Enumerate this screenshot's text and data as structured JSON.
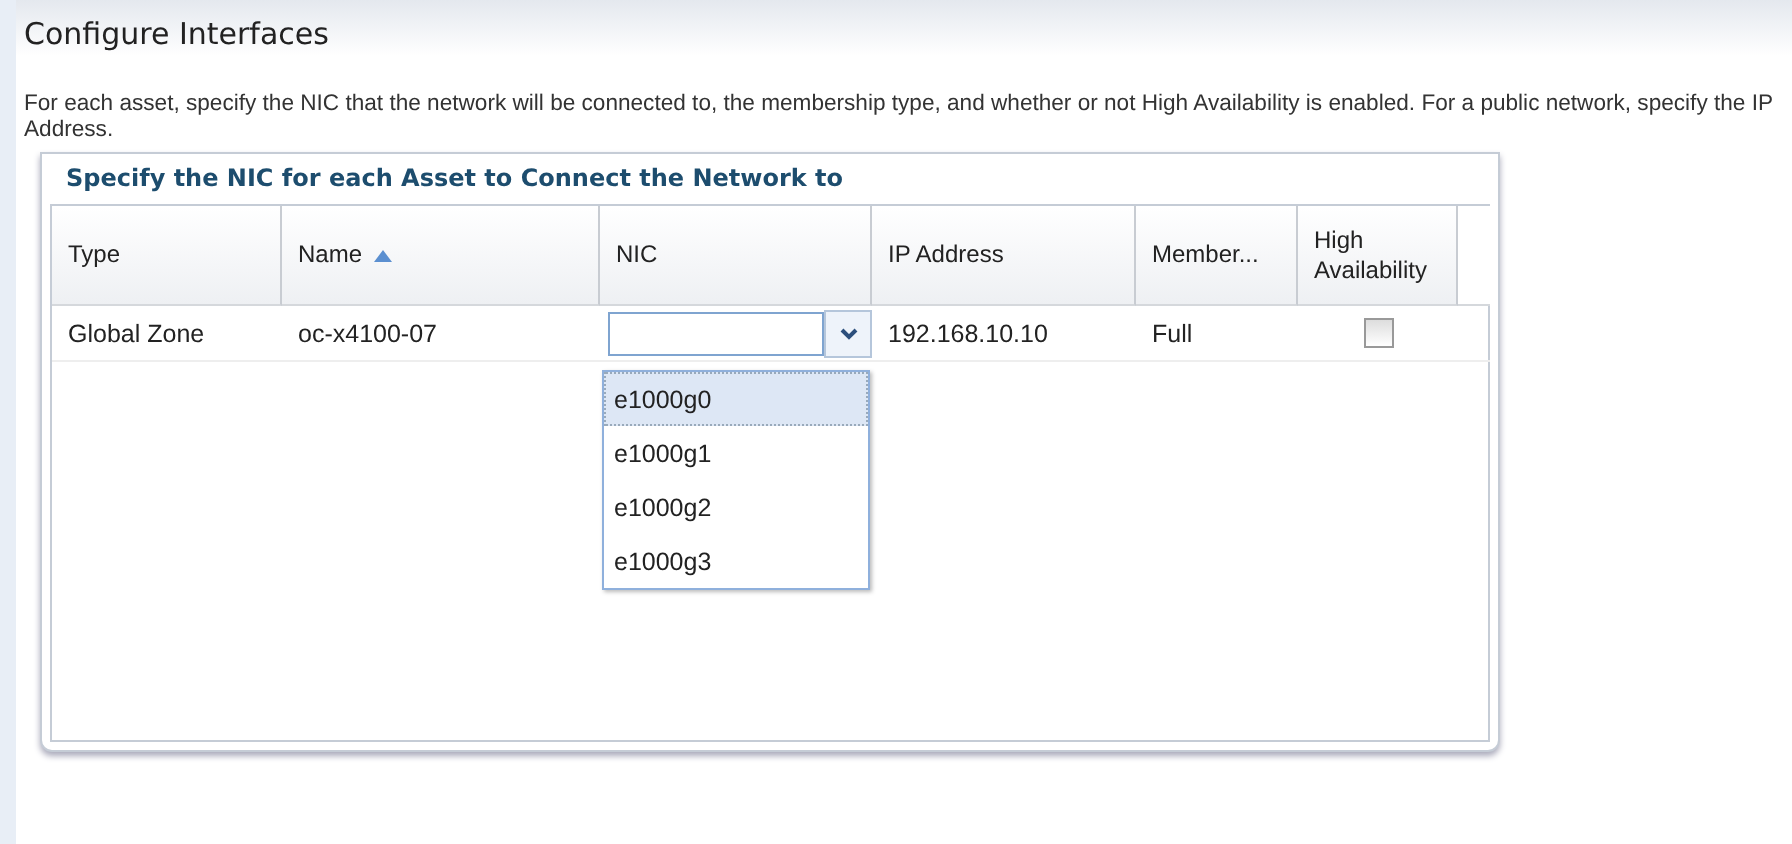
{
  "title": "Configure Interfaces",
  "description": "For each asset, specify the NIC that the network will be connected to, the membership type, and whether or not High Availability is enabled. For a public network, specify the IP Address.",
  "table": {
    "title": "Specify the NIC for each Asset to Connect the Network to",
    "columns": [
      {
        "label": "Type",
        "sorted": false
      },
      {
        "label": "Name",
        "sorted": true
      },
      {
        "label": "NIC",
        "sorted": false
      },
      {
        "label": "IP Address",
        "sorted": false
      },
      {
        "label": "Member...",
        "sorted": false
      },
      {
        "label": "High Availability",
        "sorted": false
      }
    ],
    "rows": [
      {
        "type": "Global Zone",
        "name": "oc-x4100-07",
        "nic": {
          "expanded": true,
          "options": [
            {
              "label": "e1000g0",
              "selected": true
            },
            {
              "label": "e1000g1",
              "selected": false
            },
            {
              "label": "e1000g2",
              "selected": false
            },
            {
              "label": "e1000g3",
              "selected": false
            }
          ]
        },
        "ip_address": "192.168.10.10",
        "membership": "Full",
        "high_availability": false
      }
    ]
  }
}
